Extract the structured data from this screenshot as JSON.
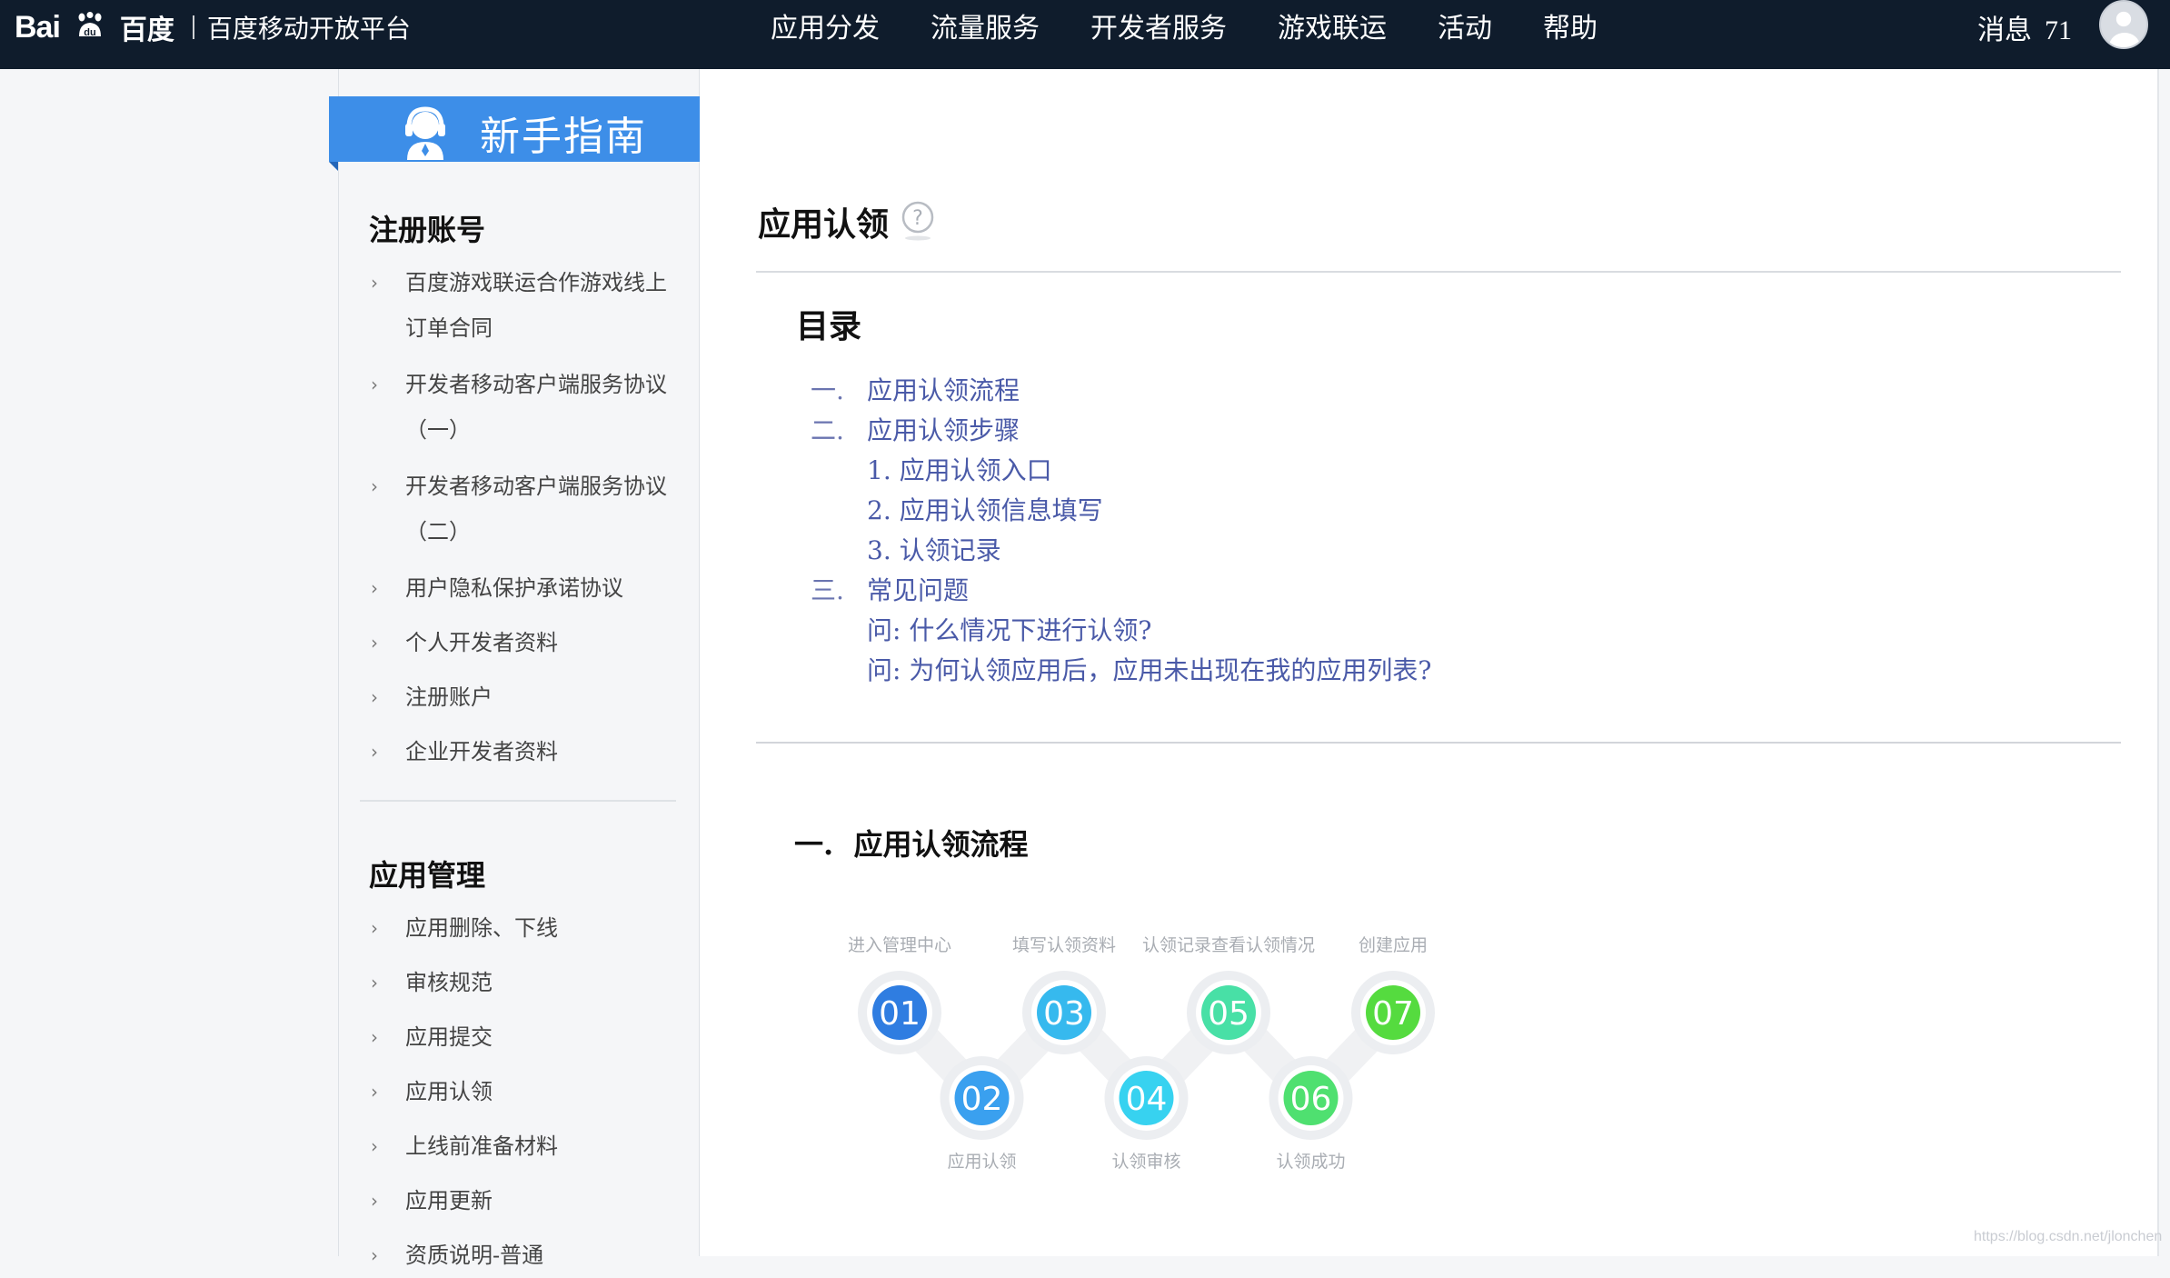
{
  "header": {
    "logo_text_latin": "Bai",
    "logo_text_latin2": "du",
    "logo_text_cn": "百度",
    "platform": "百度移动开放平台",
    "nav": [
      "应用分发",
      "流量服务",
      "开发者服务",
      "游戏联运",
      "活动",
      "帮助"
    ],
    "messages_label": "消息",
    "messages_count": "71"
  },
  "sidebar": {
    "banner_title": "新手指南",
    "sections": [
      {
        "title": "注册账号",
        "items": [
          [
            "百度游戏联运合作游戏线上",
            "订单合同"
          ],
          [
            "开发者移动客户端服务协议",
            "（一）"
          ],
          [
            "开发者移动客户端服务协议",
            "（二）"
          ],
          [
            "用户隐私保护承诺协议"
          ],
          [
            "个人开发者资料"
          ],
          [
            "注册账户"
          ],
          [
            "企业开发者资料"
          ]
        ]
      },
      {
        "title": "应用管理",
        "items": [
          [
            "应用删除、下线"
          ],
          [
            "审核规范"
          ],
          [
            "应用提交"
          ],
          [
            "应用认领"
          ],
          [
            "上线前准备材料"
          ],
          [
            "应用更新"
          ],
          [
            "资质说明-普通"
          ]
        ]
      }
    ]
  },
  "main": {
    "page_title": "应用认领",
    "toc_title": "目录",
    "toc": [
      {
        "num": "一.",
        "text": "应用认领流程",
        "level": 1
      },
      {
        "num": "二.",
        "text": "应用认领步骤",
        "level": 1
      },
      {
        "num": "",
        "text": "1. 应用认领入口",
        "level": 2
      },
      {
        "num": "",
        "text": "2. 应用认领信息填写",
        "level": 2
      },
      {
        "num": "",
        "text": "3. 认领记录",
        "level": 2
      },
      {
        "num": "三.",
        "text": "常见问题",
        "level": 1
      },
      {
        "num": "",
        "text": "问: 什么情况下进行认领?",
        "level": 2
      },
      {
        "num": "",
        "text": "问: 为何认领应用后，应用未出现在我的应用列表?",
        "level": 2
      }
    ],
    "section1_num": "一.",
    "section1_title": "应用认领流程",
    "steps": [
      {
        "num": "01",
        "label": "进入管理中心",
        "color": "#2f7de1"
      },
      {
        "num": "02",
        "label": "应用认领",
        "color": "#3aa0ef"
      },
      {
        "num": "03",
        "label": "填写认领资料",
        "color": "#36b9ee"
      },
      {
        "num": "04",
        "label": "认领审核",
        "color": "#37d2f0"
      },
      {
        "num": "05",
        "label": "认领记录查看认领情况",
        "color": "#48e0a6"
      },
      {
        "num": "06",
        "label": "认领成功",
        "color": "#4fe070"
      },
      {
        "num": "07",
        "label": "创建应用",
        "color": "#55db3f"
      }
    ]
  },
  "watermark": "https://blog.csdn.net/jlonchen"
}
